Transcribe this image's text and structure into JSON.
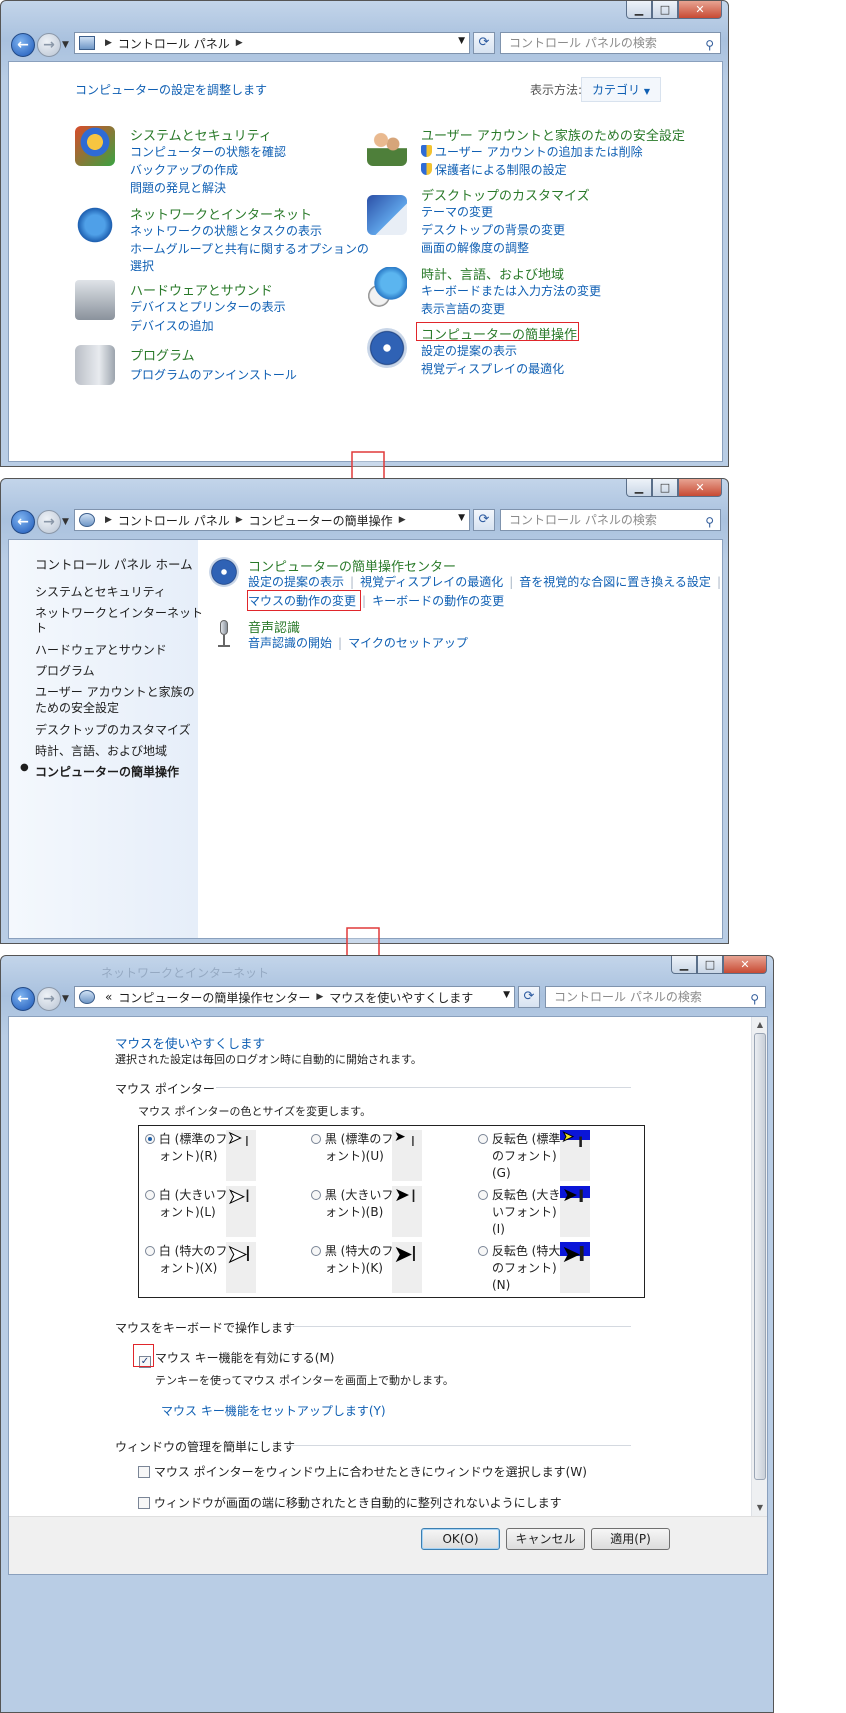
{
  "window1": {
    "address": [
      "コントロール パネル"
    ],
    "search_placeholder": "コントロール パネルの検索",
    "heading": "コンピューターの設定を調整します",
    "view_by_label": "表示方法:",
    "view_by_value": "カテゴリ",
    "left_categories": [
      {
        "title": "システムとセキュリティ",
        "links": [
          "コンピューターの状態を確認",
          "バックアップの作成",
          "問題の発見と解決"
        ]
      },
      {
        "title": "ネットワークとインターネット",
        "links": [
          "ネットワークの状態とタスクの表示",
          "ホームグループと共有に関するオプションの",
          "選択"
        ]
      },
      {
        "title": "ハードウェアとサウンド",
        "links": [
          "デバイスとプリンターの表示",
          "デバイスの追加"
        ]
      },
      {
        "title": "プログラム",
        "links": [
          "プログラムのアンインストール"
        ]
      }
    ],
    "right_categories": [
      {
        "title": "ユーザー アカウントと家族のための安全設定",
        "links": [
          "ユーザー アカウントの追加または削除",
          "保護者による制限の設定"
        ]
      },
      {
        "title": "デスクトップのカスタマイズ",
        "links": [
          "テーマの変更",
          "デスクトップの背景の変更",
          "画面の解像度の調整"
        ]
      },
      {
        "title": "時計、言語、および地域",
        "links": [
          "キーボードまたは入力方法の変更",
          "表示言語の変更"
        ]
      },
      {
        "title": "コンピューターの簡単操作",
        "links": [
          "設定の提案の表示",
          "視覚ディスプレイの最適化"
        ]
      }
    ]
  },
  "window2": {
    "address": [
      "コントロール パネル",
      "コンピューターの簡単操作"
    ],
    "search_placeholder": "コントロール パネルの検索",
    "sidebar_home": "コントロール パネル ホーム",
    "sidebar_items": [
      "システムとセキュリティ",
      "ネットワークとインターネット",
      "ハードウェアとサウンド",
      "プログラム",
      "ユーザー アカウントと家族の",
      "ための安全設定",
      "デスクトップのカスタマイズ",
      "時計、言語、および地域",
      "コンピューターの簡単操作"
    ],
    "ease_center_title": "コンピューターの簡単操作センター",
    "ease_links_row1": [
      "設定の提案の表示",
      "視覚ディスプレイの最適化",
      "音を視覚的な合図に置き換える設定"
    ],
    "ease_links_row2": [
      "マウスの動作の変更",
      "キーボードの動作の変更"
    ],
    "speech_title": "音声認識",
    "speech_links": [
      "音声認識の開始",
      "マイクのセットアップ"
    ]
  },
  "window3": {
    "address_prefix": "«",
    "address": [
      "コンピューターの簡単操作センター",
      "マウスを使いやすくします"
    ],
    "search_placeholder": "コントロール パネルの検索",
    "page_title": "マウスを使いやすくします",
    "page_subtitle": "選択された設定は毎回のログオン時に自動的に開始されます。",
    "pointer_group": "マウス ポインター",
    "pointer_desc": "マウス ポインターの色とサイズを変更します。",
    "pointer_options": [
      {
        "l1": "白 (標準のフ",
        "l2": "ォント)(R)",
        "l3": ""
      },
      {
        "l1": "黒 (標準のフ",
        "l2": "ォント)(U)",
        "l3": ""
      },
      {
        "l1": "反転色 (標準",
        "l2": "のフォント)",
        "l3": "(G)"
      },
      {
        "l1": "白 (大きいフ",
        "l2": "ォント)(L)",
        "l3": ""
      },
      {
        "l1": "黒 (大きいフ",
        "l2": "ォント)(B)",
        "l3": ""
      },
      {
        "l1": "反転色 (大き",
        "l2": "いフォント)",
        "l3": "(I)"
      },
      {
        "l1": "白 (特大のフ",
        "l2": "ォント)(X)",
        "l3": ""
      },
      {
        "l1": "黒 (特大のフ",
        "l2": "ォント)(K)",
        "l3": ""
      },
      {
        "l1": "反転色 (特大",
        "l2": "のフォント)",
        "l3": "(N)"
      }
    ],
    "keyboard_group": "マウスをキーボードで操作します",
    "mousekeys_label": "マウス キー機能を有効にする(M)",
    "mousekeys_desc": "テンキーを使ってマウス ポインターを画面上で動かします。",
    "mousekeys_setup": "マウス キー機能をセットアップします(Y)",
    "window_group": "ウィンドウの管理を簡単にします",
    "hover_activate": "マウス ポインターをウィンドウ上に合わせたときにウィンドウを選択します(W)",
    "prevent_arrange": "ウィンドウが画面の端に移動されたとき自動的に整列されないようにします",
    "ok": "OK(O)",
    "cancel": "キャンセル",
    "apply": "適用(P)",
    "bg_ghost": "ネットワークとインターネット"
  },
  "colors": {
    "link": "#0f5fb3",
    "category_title": "#2a7a2a",
    "highlight_box": "#e0262b"
  }
}
